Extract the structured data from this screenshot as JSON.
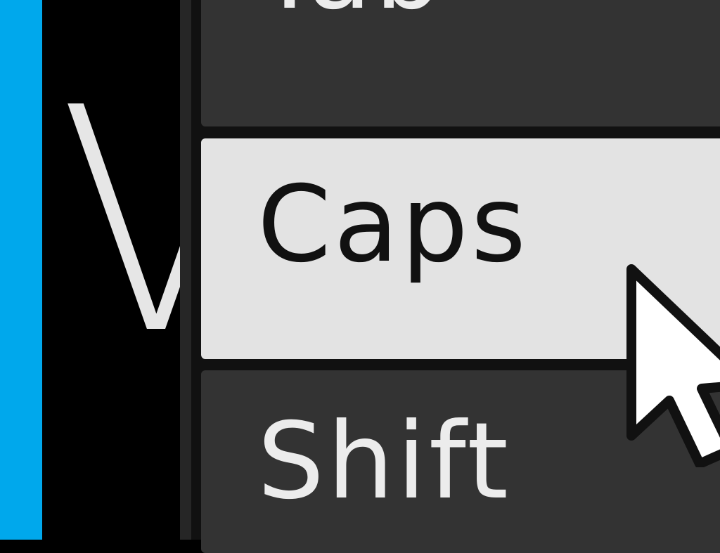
{
  "sidebar": {
    "accent_color": "#00a8ec",
    "current_key_letter": "V"
  },
  "keys": [
    {
      "label": "Tab",
      "state": "normal"
    },
    {
      "label": "Caps",
      "state": "hovered"
    },
    {
      "label": "Shift",
      "state": "normal"
    }
  ],
  "colors": {
    "row_background": "#333333",
    "row_hover_background": "#e3e3e3",
    "row_text": "#ececec",
    "row_hover_text": "#111111"
  },
  "cursor": {
    "icon": "mouse-pointer-icon"
  }
}
